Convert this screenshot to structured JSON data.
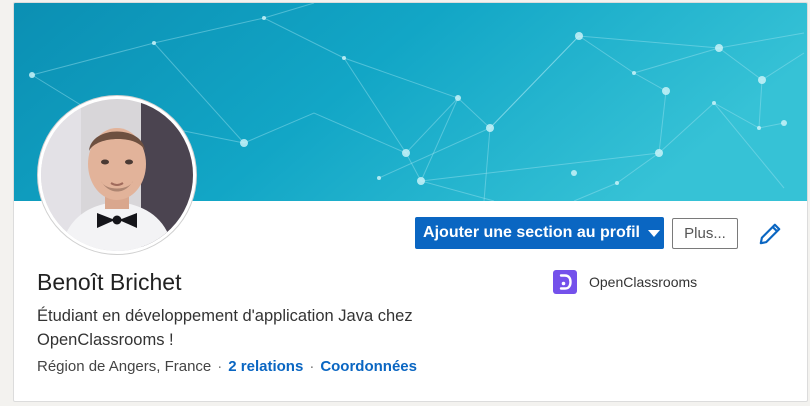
{
  "profile": {
    "name": "Benoît Brichet",
    "headline": "Étudiant en développement d'application Java chez OpenClassrooms !",
    "location": "Région de Angers, France",
    "relations": "2 relations",
    "contact": "Coordonnées",
    "separator": "·"
  },
  "actions": {
    "add_section_label": "Ajouter une section au profil",
    "more_label": "Plus..."
  },
  "company": {
    "name": "OpenClassrooms"
  },
  "icons": {
    "edit": "pencil-icon",
    "add_section_dropdown": "caret-down-icon",
    "company_logo": "openclassrooms-logo"
  },
  "colors": {
    "primary": "#0a66c2",
    "banner_start": "#0b8fb3",
    "banner_end": "#36c2d6",
    "company_brand": "#7451eb"
  }
}
